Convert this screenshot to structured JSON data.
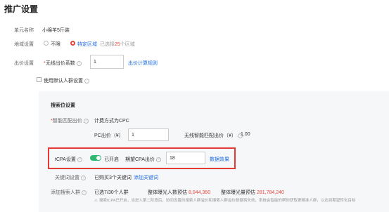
{
  "page_title": "推广设置",
  "unit_name": {
    "label": "单元名称",
    "value": "小绵羊5斤装"
  },
  "region": {
    "label": "地域设置",
    "options": [
      "不限",
      "特定区域"
    ],
    "selected_index": 1,
    "selected_prefix": "已选择",
    "selected_count": "25",
    "selected_suffix": "个区域"
  },
  "bid": {
    "label": "出价设置",
    "sub_label": "无线出价系数",
    "value": "1",
    "rule_link": "出价计算规则"
  },
  "default_crowd": {
    "label": "使用默认人群设置",
    "checked": false
  },
  "slot": {
    "section_title": "搜索位设置",
    "smart_match_label": "智能匹配出价",
    "method_text": "计费方式为CPC",
    "pc_bid_label": "PC出价（¥）",
    "pc_bid_value": "1",
    "wireless_label": "无线智能匹配出价（¥）",
    "wireless_value": "1.00"
  },
  "tcpa": {
    "label": "tCPA设置",
    "toggle_on": true,
    "toggle_text": "已开启",
    "expect_label": "期望CPA出价",
    "expect_value": "18",
    "effect_link": "数据效果"
  },
  "keyword": {
    "label": "关键词设置",
    "bought_text": "已购买3个关键词",
    "add_link": "添加关键词"
  },
  "crowd": {
    "label": "添加搜索人群",
    "selected_text": "已选7/30个人群",
    "exposure_people_label": "整体曝光人数预估",
    "exposure_people_value": "8,044,360",
    "exposure_count_label": "整体曝光量预估",
    "exposure_count_value": "281,784,240",
    "notice_line1": "搜索tCPA已开启，当进入第二阶段后，协同设置的搜索人群溢价和搜索人群溢价数据将失效，系统会智能的帮你获取更精准人群，以达到期望转化目标"
  },
  "colors": {
    "accent_red": "#e8453c",
    "link_blue": "#1f6ce0",
    "toggle_green": "#2eb872",
    "highlight_border": "#e53935"
  }
}
